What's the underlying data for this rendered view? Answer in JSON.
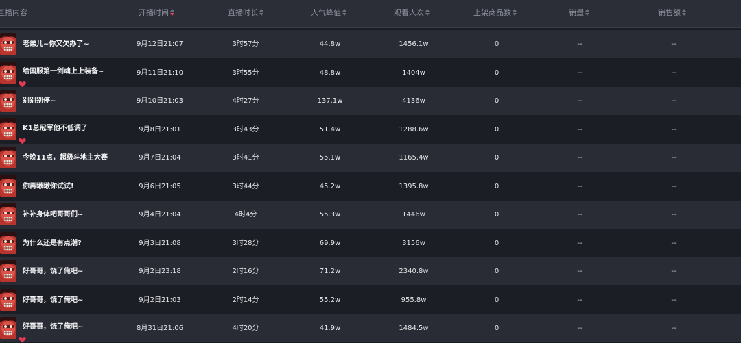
{
  "header": {
    "content": "直播内容",
    "start_time": "开播时间",
    "duration": "直播时长",
    "peak_popularity": "人气峰值",
    "viewers": "观看人次",
    "products": "上架商品数",
    "sales": "销量",
    "revenue": "销售额"
  },
  "colors": {
    "active_sort": "#e8465f",
    "inactive_sort": "#6d717c",
    "badge": "#e23a55"
  },
  "rows": [
    {
      "title": "老弟儿~你又欠办了~",
      "time": "9月12日21:07",
      "duration": "3时57分",
      "peak": "44.8w",
      "viewers": "1456.1w",
      "products": "0",
      "sales": "--",
      "revenue": "--",
      "badge": false
    },
    {
      "title": "给国服第一剑魂上上装备~",
      "time": "9月11日21:10",
      "duration": "3时55分",
      "peak": "48.8w",
      "viewers": "1404w",
      "products": "0",
      "sales": "--",
      "revenue": "--",
      "badge": true
    },
    {
      "title": "别别别停~",
      "time": "9月10日21:03",
      "duration": "4时27分",
      "peak": "137.1w",
      "viewers": "4136w",
      "products": "0",
      "sales": "--",
      "revenue": "--",
      "badge": false
    },
    {
      "title": "K1总冠军他不低调了",
      "time": "9月8日21:01",
      "duration": "3时43分",
      "peak": "51.4w",
      "viewers": "1288.6w",
      "products": "0",
      "sales": "--",
      "revenue": "--",
      "badge": true
    },
    {
      "title": "今晚11点，超级斗地主大赛",
      "time": "9月7日21:04",
      "duration": "3时41分",
      "peak": "55.1w",
      "viewers": "1165.4w",
      "products": "0",
      "sales": "--",
      "revenue": "--",
      "badge": false
    },
    {
      "title": "你再瞅瞅你试试!",
      "time": "9月6日21:05",
      "duration": "3时44分",
      "peak": "45.2w",
      "viewers": "1395.8w",
      "products": "0",
      "sales": "--",
      "revenue": "--",
      "badge": false
    },
    {
      "title": "补补身体吧哥哥们~",
      "time": "9月4日21:04",
      "duration": "4时4分",
      "peak": "55.3w",
      "viewers": "1446w",
      "products": "0",
      "sales": "--",
      "revenue": "--",
      "badge": false
    },
    {
      "title": "为什么还是有点潮?",
      "time": "9月3日21:08",
      "duration": "3时28分",
      "peak": "69.9w",
      "viewers": "3156w",
      "products": "0",
      "sales": "--",
      "revenue": "--",
      "badge": false
    },
    {
      "title": "好哥哥，饶了俺吧~",
      "time": "9月2日23:18",
      "duration": "2时16分",
      "peak": "71.2w",
      "viewers": "2340.8w",
      "products": "0",
      "sales": "--",
      "revenue": "--",
      "badge": false
    },
    {
      "title": "好哥哥，饶了俺吧~",
      "time": "9月2日21:03",
      "duration": "2时14分",
      "peak": "55.2w",
      "viewers": "955.8w",
      "products": "0",
      "sales": "--",
      "revenue": "--",
      "badge": false
    },
    {
      "title": "好哥哥，饶了俺吧~",
      "time": "8月31日21:06",
      "duration": "4时20分",
      "peak": "41.9w",
      "viewers": "1484.5w",
      "products": "0",
      "sales": "--",
      "revenue": "--",
      "badge": true
    }
  ]
}
